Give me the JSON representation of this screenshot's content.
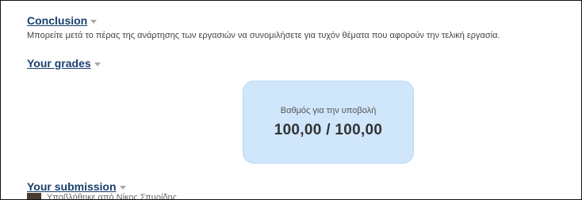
{
  "sections": {
    "conclusion": {
      "title": "Conclusion",
      "description": "Μπορείτε μετά το πέρας της ανάρτησης των εργασιών να συνομιλήσετε για τυχόν θέματα που αφορούν την τελική εργασία."
    },
    "grades": {
      "title": "Your grades",
      "grade_label": "Βαθμός για την υποβολή",
      "grade_value": "100,00 / 100,00"
    },
    "submission": {
      "title": "Your submission",
      "partial_text": "Υποβλήθηκε από Νίκος Σπυρίδης"
    }
  },
  "icons": {
    "toggle": "chevron-down-icon",
    "avatar": "avatar"
  },
  "colors": {
    "heading": "#1a3f6e",
    "grade_box": "#cfe6fb"
  }
}
